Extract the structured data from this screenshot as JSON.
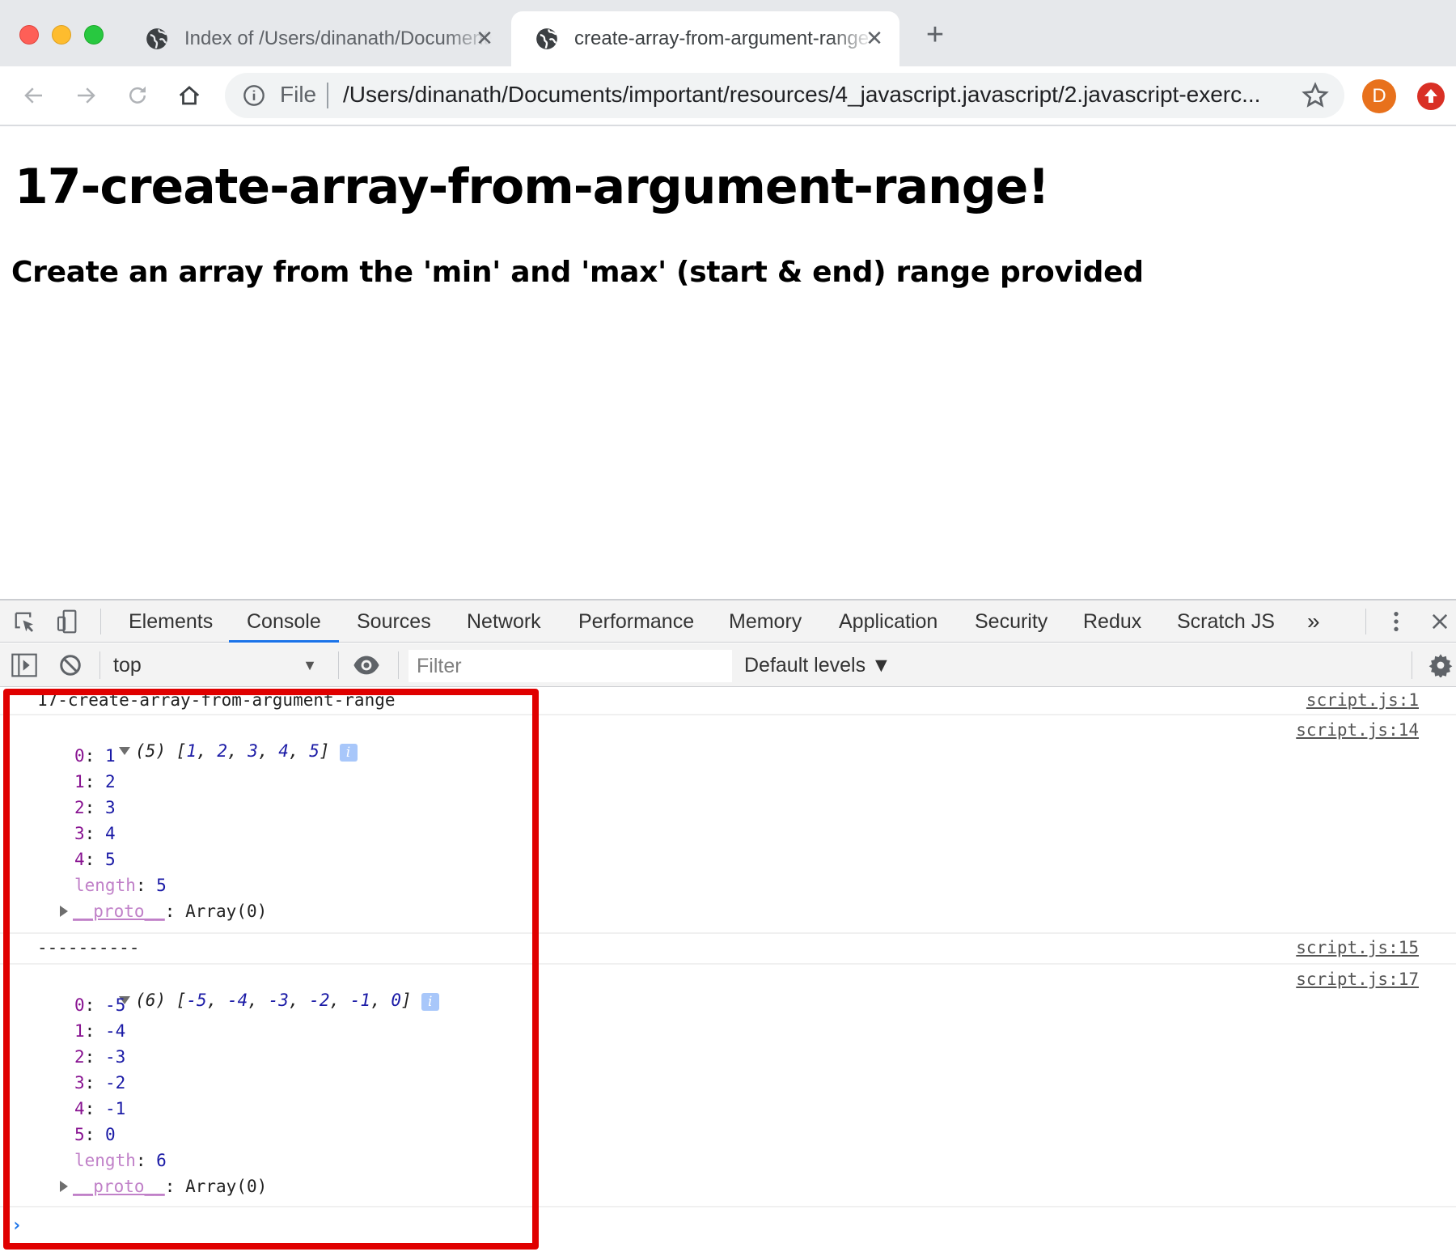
{
  "browser": {
    "tabs": [
      {
        "title": "Index of /Users/dinanath/Documents",
        "icon": "globe-icon",
        "active": false
      },
      {
        "title": "create-array-from-argument-range",
        "icon": "globe-icon",
        "active": true
      }
    ],
    "new_tab_label": "+",
    "close_label": "✕",
    "omnibox": {
      "scheme_label": "File",
      "url": "/Users/dinanath/Documents/important/resources/4_javascript.javascript/2.javascript-exerc..."
    },
    "avatar_letter": "D",
    "colors": {
      "avatar": "#e8711c",
      "extension": "#d93025",
      "accent": "#1a73e8"
    }
  },
  "page": {
    "heading": "17-create-array-from-argument-range!",
    "subheading": "Create an array from the 'min' and 'max' (start & end) range provided"
  },
  "devtools": {
    "tabs": [
      "Elements",
      "Console",
      "Sources",
      "Network",
      "Performance",
      "Memory",
      "Application",
      "Security",
      "Redux",
      "Scratch JS"
    ],
    "active_tab": "Console",
    "more_tabs_label": "»",
    "context": "top",
    "filter_placeholder": "Filter",
    "levels_label": "Default levels ▼",
    "messages": [
      {
        "text": "17-create-array-from-argument-range",
        "source": "script.js:1"
      },
      {
        "summary_count": "(5)",
        "summary_values": [
          "1",
          "2",
          "3",
          "4",
          "5"
        ],
        "entries": [
          {
            "key": "0",
            "value": "1"
          },
          {
            "key": "1",
            "value": "2"
          },
          {
            "key": "2",
            "value": "3"
          },
          {
            "key": "3",
            "value": "4"
          },
          {
            "key": "4",
            "value": "5"
          }
        ],
        "length_key": "length",
        "length_value": "5",
        "proto_key": "__proto__",
        "proto_value": "Array(0)",
        "source": "script.js:14"
      },
      {
        "text": "----------",
        "source": "script.js:15"
      },
      {
        "summary_count": "(6)",
        "summary_values": [
          "-5",
          "-4",
          "-3",
          "-2",
          "-1",
          "0"
        ],
        "entries": [
          {
            "key": "0",
            "value": "-5"
          },
          {
            "key": "1",
            "value": "-4"
          },
          {
            "key": "2",
            "value": "-3"
          },
          {
            "key": "3",
            "value": "-2"
          },
          {
            "key": "4",
            "value": "-1"
          },
          {
            "key": "5",
            "value": "0"
          }
        ],
        "length_key": "length",
        "length_value": "6",
        "proto_key": "__proto__",
        "proto_value": "Array(0)",
        "source": "script.js:17"
      }
    ],
    "prompt": "›",
    "highlight_color": "#e00000"
  }
}
